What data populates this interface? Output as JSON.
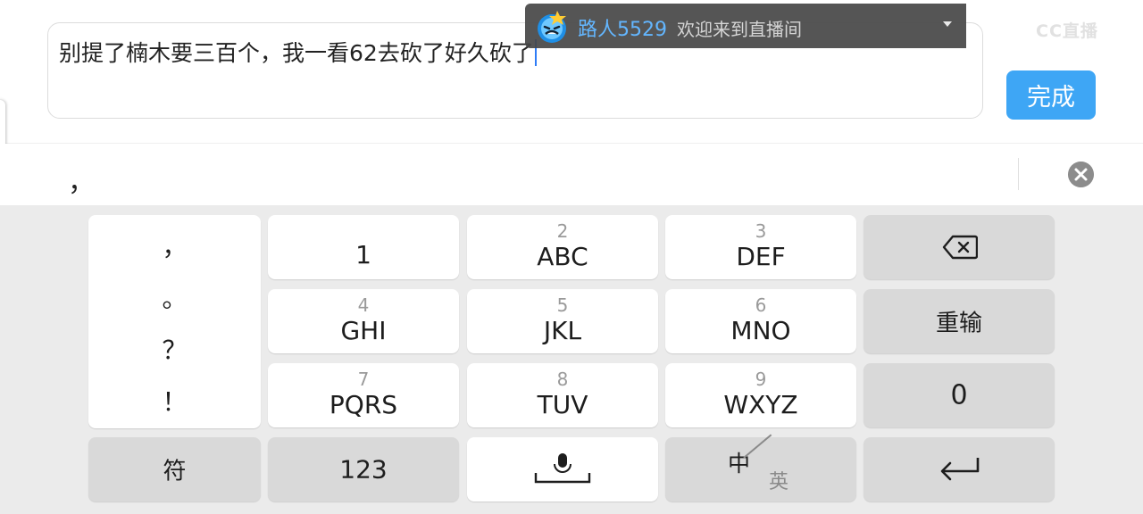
{
  "input": {
    "text": "别提了楠木要三百个，我一看62去砍了好久砍了",
    "done_label": "完成"
  },
  "overlay": {
    "user": "路人5529",
    "message": "欢迎来到直播间",
    "watermark": "CC直播"
  },
  "candidate": {
    "text": "，"
  },
  "keyboard": {
    "punctuation": [
      "，",
      "。",
      "？",
      "！"
    ],
    "keys": {
      "k1": {
        "num": "",
        "letters": "1"
      },
      "k2": {
        "num": "2",
        "letters": "ABC"
      },
      "k3": {
        "num": "3",
        "letters": "DEF"
      },
      "k4": {
        "num": "4",
        "letters": "GHI"
      },
      "k5": {
        "num": "5",
        "letters": "JKL"
      },
      "k6": {
        "num": "6",
        "letters": "MNO"
      },
      "k7": {
        "num": "7",
        "letters": "PQRS"
      },
      "k8": {
        "num": "8",
        "letters": "TUV"
      },
      "k9": {
        "num": "9",
        "letters": "WXYZ"
      }
    },
    "reset_label": "重输",
    "zero_label": "0",
    "symbol_label": "符",
    "numeric_label": "123",
    "lang_zh": "中",
    "lang_en": "英"
  },
  "icons": {
    "backspace": "backspace-icon",
    "mic": "microphone-icon",
    "enter": "enter-icon",
    "clear": "clear-icon",
    "dropdown": "chevron-down-icon",
    "avatar": "avatar-icon"
  },
  "colors": {
    "accent": "#3ea6f5",
    "caret": "#2e7cf6",
    "username": "#63b6ff",
    "keyboard_bg": "#ebebeb",
    "function_key": "#d9d9d9"
  }
}
